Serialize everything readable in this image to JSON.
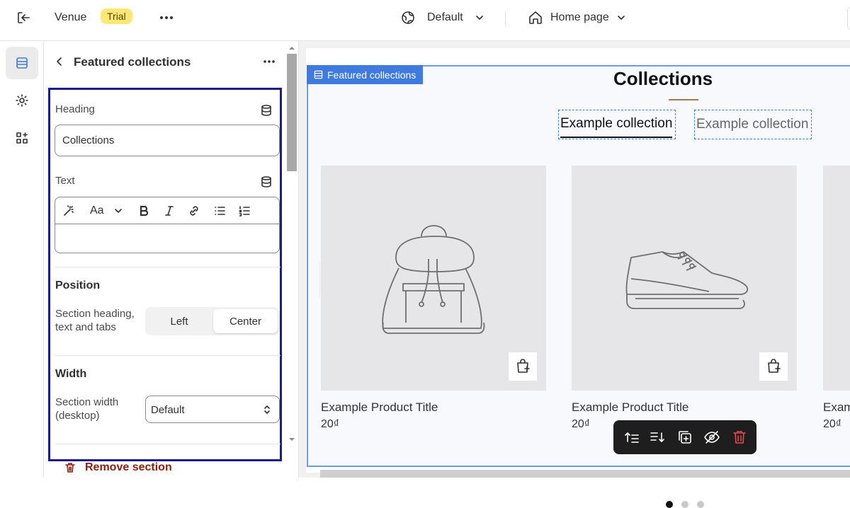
{
  "topbar": {
    "store_name": "Venue",
    "plan_badge": "Trial",
    "theme_label": "Default",
    "page_label": "Home page"
  },
  "panel": {
    "title": "Featured collections",
    "heading_label": "Heading",
    "heading_value": "Collections",
    "text_label": "Text",
    "position_title": "Position",
    "position_label_line1": "Section heading,",
    "position_label_line2": "text and tabs",
    "position_options": [
      "Left",
      "Center"
    ],
    "position_selected": "Center",
    "width_title": "Width",
    "width_label_line1": "Section width",
    "width_label_line2": "(desktop)",
    "width_value": "Default",
    "remove_label": "Remove section"
  },
  "editor_toolbar": {
    "font_label": "Aa"
  },
  "preview": {
    "section_tag": "Featured collections",
    "collection_title": "Collections",
    "tabs": [
      "Example collection",
      "Example collection"
    ],
    "products": [
      {
        "title": "Example Product Title",
        "price": "20₫"
      },
      {
        "title": "Example Product Title",
        "price": "20₫"
      },
      {
        "title": "Exam",
        "price": "20₫"
      }
    ]
  },
  "colors": {
    "accent": "#3f7ae0",
    "selection_outline": "#1c1c8c",
    "badge": "#ffe776",
    "danger": "#8e1f0b",
    "delete_icon": "#e5484d"
  }
}
